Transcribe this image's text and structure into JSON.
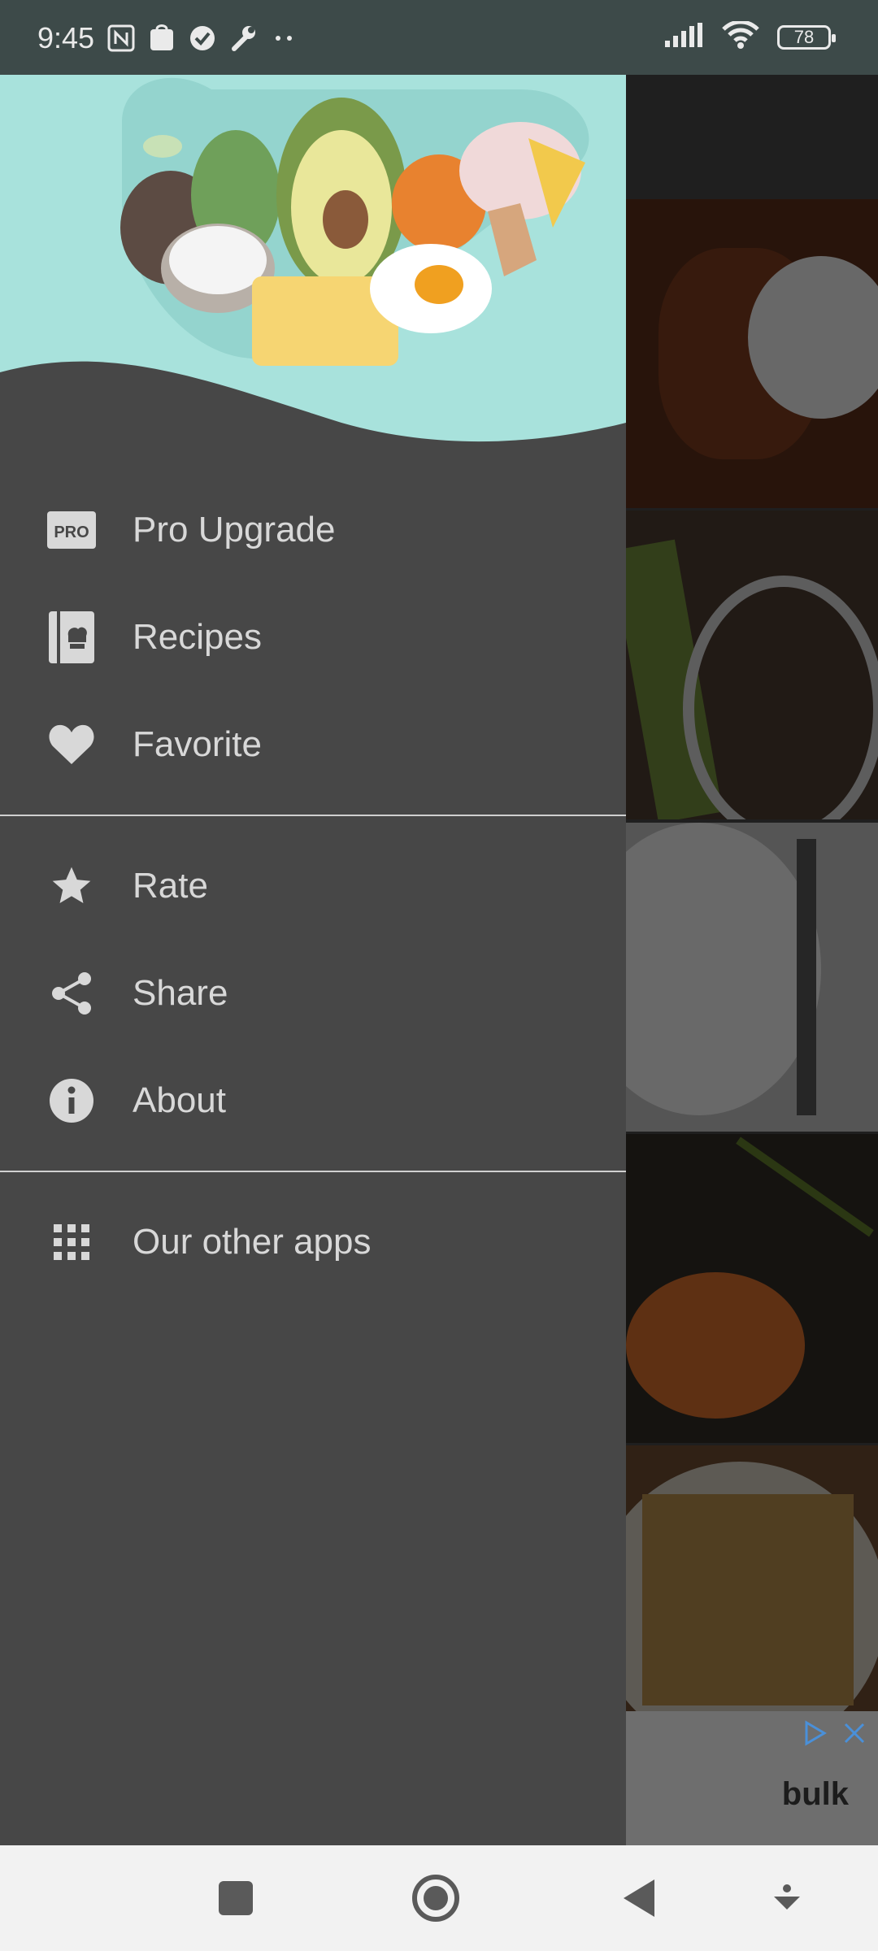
{
  "status_bar": {
    "time": "9:45",
    "battery": "78"
  },
  "drawer": {
    "groups": [
      [
        {
          "label": "Pro Upgrade",
          "icon": "pro-icon"
        },
        {
          "label": "Recipes",
          "icon": "recipe-book-icon"
        },
        {
          "label": "Favorite",
          "icon": "heart-icon"
        }
      ],
      [
        {
          "label": "Rate",
          "icon": "star-icon"
        },
        {
          "label": "Share",
          "icon": "share-icon"
        },
        {
          "label": "About",
          "icon": "info-icon"
        }
      ],
      [
        {
          "label": "Our other apps",
          "icon": "grid-icon"
        }
      ]
    ],
    "pro_badge": "PRO"
  },
  "ad": {
    "brand": "bulk"
  },
  "colors": {
    "drawer_bg": "#474747",
    "header_bg": "#a8e2dc",
    "status_bar_bg": "#3d4a49",
    "nav_bar_bg": "#f2f2f2"
  }
}
